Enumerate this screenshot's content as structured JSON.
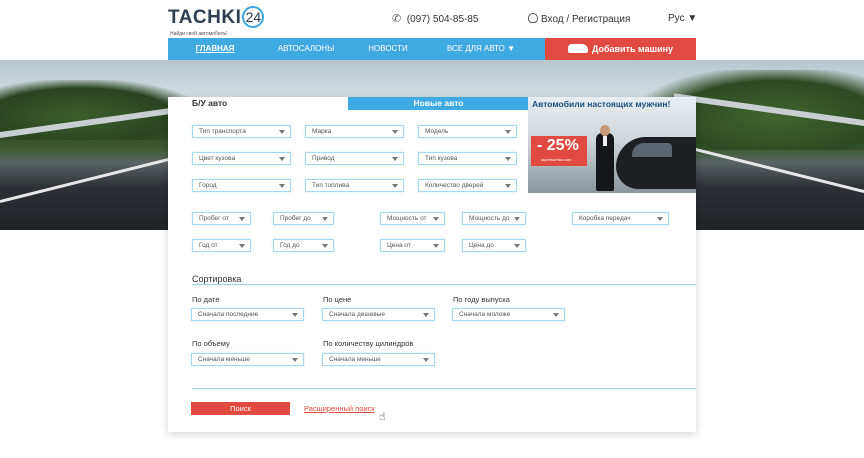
{
  "header": {
    "logo_main": "TACHKI",
    "logo_num": "24",
    "tagline": "Найди свой автомобиль!",
    "phone": "(097) 504-85-85",
    "login": "Вход / Регистрация",
    "lang": "Рус"
  },
  "nav": {
    "items": [
      {
        "label": "ГЛАВНАЯ"
      },
      {
        "label": "АВТОСАЛОНЫ"
      },
      {
        "label": "НОВОСТИ"
      },
      {
        "label": "ВСЕ ДЛЯ АВТО"
      }
    ],
    "add_car": "Добавить машину"
  },
  "tabs": {
    "used": "Б/У авто",
    "new": "Новые авто"
  },
  "filters": {
    "row1": [
      "Тип транспорта",
      "Марка",
      "Модель"
    ],
    "row2": [
      "Цвет кузова",
      "Привод",
      "Тип кузова"
    ],
    "row3": [
      "Город",
      "Тип топлива",
      "Количество дверей"
    ],
    "row4": [
      "Пробег от",
      "Пробег до",
      "Мощность от",
      "Мощность до",
      "Коробка передач"
    ],
    "row5": [
      "Год от",
      "Год до",
      "Цена от",
      "Цена до"
    ]
  },
  "sort": {
    "title": "Сортировка",
    "by_date_label": "По дате",
    "by_date_value": "Сначала последние",
    "by_price_label": "По цене",
    "by_price_value": "Сначала дешевые",
    "by_year_label": "По году выпуска",
    "by_year_value": "Сначала моложе",
    "by_volume_label": "По объему",
    "by_volume_value": "Сначала меньше",
    "by_cyl_label": "По количеству цилиндров",
    "by_cyl_value": "Сначала меньше"
  },
  "actions": {
    "search": "Поиск",
    "advanced": "Расширенный поиск"
  },
  "ad": {
    "title": "Автомобили настоящих мужчин!",
    "discount": "- 25%",
    "site": "supertachka.com"
  },
  "colors": {
    "accent_blue": "#3fa9e2",
    "accent_red": "#e04a41"
  }
}
